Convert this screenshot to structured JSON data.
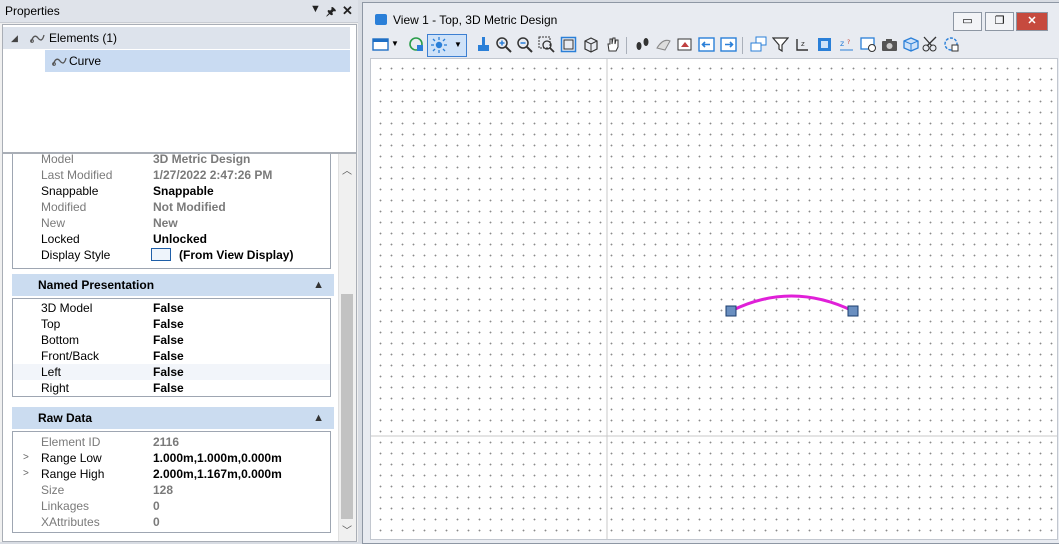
{
  "properties": {
    "title": "Properties",
    "tree": {
      "elements_label": "Elements (1)",
      "curve_label": "Curve"
    },
    "general_rows": [
      {
        "key": "Model",
        "value": "3D Metric Design",
        "dim": true
      },
      {
        "key": "Last Modified",
        "value": "1/27/2022 2:47:26 PM",
        "dim": true
      },
      {
        "key": "Snappable",
        "value": "Snappable",
        "dim": false
      },
      {
        "key": "Modified",
        "value": "Not Modified",
        "dim": true
      },
      {
        "key": "New",
        "value": "New",
        "dim": true
      },
      {
        "key": "Locked",
        "value": "Unlocked",
        "dim": false
      },
      {
        "key": "Display Style",
        "value": "(From View Display)",
        "dim": false
      }
    ],
    "named_presentation": {
      "header": "Named Presentation",
      "rows": [
        {
          "key": "3D Model",
          "value": "False"
        },
        {
          "key": "Top",
          "value": "False"
        },
        {
          "key": "Bottom",
          "value": "False"
        },
        {
          "key": "Front/Back",
          "value": "False"
        },
        {
          "key": "Left",
          "value": "False"
        },
        {
          "key": "Right",
          "value": "False"
        }
      ]
    },
    "raw_data": {
      "header": "Raw Data",
      "rows": [
        {
          "key": "Element ID",
          "value": "2116",
          "dim": true
        },
        {
          "key": "Range Low",
          "value": "1.000m,1.000m,0.000m",
          "dim": false
        },
        {
          "key": "Range High",
          "value": "2.000m,1.167m,0.000m",
          "dim": false
        },
        {
          "key": "Size",
          "value": "128",
          "dim": true
        },
        {
          "key": "Linkages",
          "value": "0",
          "dim": true
        },
        {
          "key": "XAttributes",
          "value": "0",
          "dim": true
        }
      ]
    }
  },
  "view": {
    "title": "View 1 - Top, 3D Metric Design",
    "curve_color": "#e020d8",
    "handle_color": "#6a8fc0"
  }
}
